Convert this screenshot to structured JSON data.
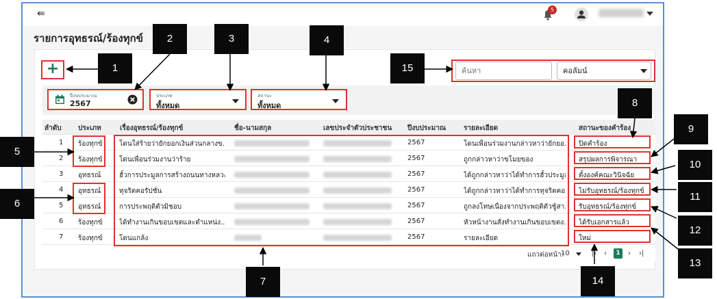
{
  "header": {
    "notification_count": "5",
    "page_title": "รายการอุทธรณ์/ร้องทุกข์"
  },
  "toolbar": {
    "add_label": "+",
    "search_placeholder": "ค้นหา",
    "column_select": "คอลัมน์"
  },
  "filters": {
    "year_label": "ปีงบประมาณ",
    "year_value": "2567",
    "type_label": "ประเภท",
    "type_value": "ทั้งหมด",
    "status_label": "สถานะ",
    "status_value": "ทั้งหมด"
  },
  "table": {
    "headers": [
      "ลำดับ",
      "ประเภท",
      "เรื่องอุทธรณ์/ร้องทุกข์",
      "ชื่อ-นามสกุล",
      "เลขประจำตัวประชาชน",
      "ปีงบประมาณ",
      "รายละเอียด",
      "สถานะของคำร้อง"
    ],
    "rows": [
      {
        "no": "1",
        "type": "ร้องทุกข์",
        "subject": "โดนใส่ร้ายว่ายักยอกเงินส่วนกลางข...",
        "year": "2567",
        "detail": "โดนเพื่อนร่วมงานกล่าวหาว่ายักยอ...",
        "status": "ปิดคำร้อง"
      },
      {
        "no": "2",
        "type": "ร้องทุกข์",
        "subject": "โดนเพื่อนร่วมงานว่าร้าย",
        "year": "2567",
        "detail": "ถูกกล่าวหาว่าขโมยของ",
        "status": "สรุปผลการพิจารณา"
      },
      {
        "no": "3",
        "type": "อุทธรณ์",
        "subject": "ฮั้วการประมูลการสร้างถนนทางหลวง",
        "year": "2567",
        "detail": "ได้ถูกกล่าวหาว่าได้ทำการฮั้วประมูลก...",
        "status": "ตั้งองค์คณะวินิจฉัย"
      },
      {
        "no": "4",
        "type": "อุทธรณ์",
        "subject": "ทุจริตคอรัปชั่น",
        "year": "2567",
        "detail": "ได้ถูกกล่าวหาว่าได้ทำการทุจริตคอร์...",
        "status": "ไม่รับอุทธรณ์/ร้องทุกข์"
      },
      {
        "no": "5",
        "type": "อุทธรณ์",
        "subject": "การประพฤติตัวมิชอบ",
        "year": "2567",
        "detail": "ถูกลงโทษเนื่องจากประพฤติตัวชู้สา...",
        "status": "รับอุทธรณ์/ร้องทุกข์"
      },
      {
        "no": "6",
        "type": "ร้องทุกข์",
        "subject": "ได้ทำงานเกินขอบเขตและตำแหน่ง...",
        "year": "2567",
        "detail": "หัวหน้างานสั่งทำงานเกินขอบเขตง...",
        "status": "ได้รับเอกสารแล้ว"
      },
      {
        "no": "7",
        "type": "ร้องทุกข์",
        "subject": "โดนแกล้ง",
        "year": "2567",
        "detail": "รายละเอียด",
        "status": "ใหม่"
      }
    ]
  },
  "pagination": {
    "rows_per_page_label": "แถวต่อหน้า:",
    "rows_per_page_value": "10",
    "current_page": "1"
  },
  "markers": [
    "1",
    "2",
    "3",
    "4",
    "5",
    "6",
    "7",
    "8",
    "9",
    "10",
    "11",
    "12",
    "13",
    "14",
    "15"
  ],
  "colors": {
    "accent": "#1b7c5a",
    "highlight_border": "#e03030",
    "frame_border": "#5b8fcf",
    "badge": "#c62828"
  }
}
